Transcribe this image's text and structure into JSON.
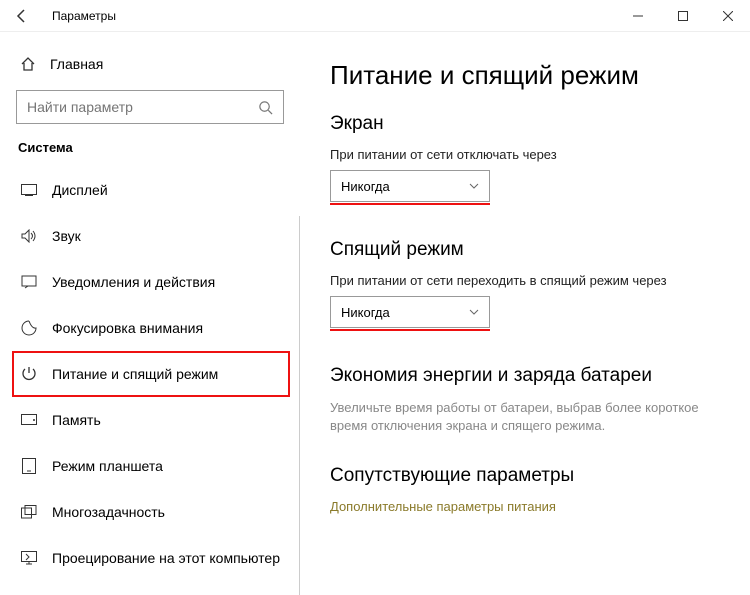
{
  "window": {
    "title": "Параметры"
  },
  "sidebar": {
    "home": "Главная",
    "search_placeholder": "Найти параметр",
    "group": "Система",
    "items": [
      {
        "label": "Дисплей"
      },
      {
        "label": "Звук"
      },
      {
        "label": "Уведомления и действия"
      },
      {
        "label": "Фокусировка внимания"
      },
      {
        "label": "Питание и спящий режим"
      },
      {
        "label": "Память"
      },
      {
        "label": "Режим планшета"
      },
      {
        "label": "Многозадачность"
      },
      {
        "label": "Проецирование на этот компьютер"
      }
    ]
  },
  "content": {
    "heading": "Питание и спящий режим",
    "screen": {
      "title": "Экран",
      "label": "При питании от сети отключать через",
      "value": "Никогда"
    },
    "sleep": {
      "title": "Спящий режим",
      "label": "При питании от сети переходить в спящий режим через",
      "value": "Никогда"
    },
    "battery": {
      "title": "Экономия энергии и заряда батареи",
      "desc": "Увеличьте время работы от батареи, выбрав более короткое время отключения экрана и спящего режима."
    },
    "related": {
      "title": "Сопутствующие параметры",
      "link": "Дополнительные параметры питания"
    }
  }
}
